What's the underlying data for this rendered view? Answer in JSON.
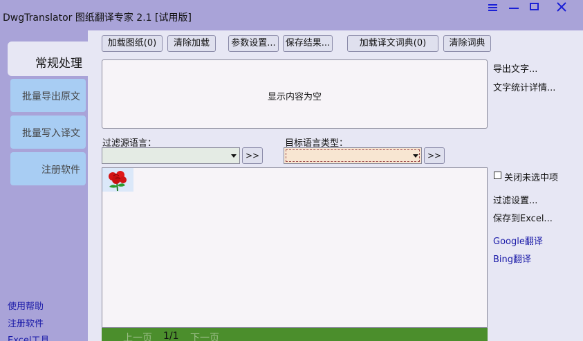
{
  "window": {
    "title": "DwgTranslator 图纸翻译专家 2.1 [试用版]",
    "controls": [
      "menu-icon",
      "minimize-icon",
      "maximize-icon",
      "close-icon"
    ]
  },
  "sidebar": {
    "tabs": [
      {
        "label": "常规处理",
        "active": true
      },
      {
        "label": "批量导出原文",
        "active": false
      },
      {
        "label": "批量写入译文",
        "active": false
      },
      {
        "label": "注册软件",
        "active": false
      }
    ],
    "links": [
      "使用帮助",
      "注册软件",
      "Excel工具"
    ]
  },
  "toolbar": {
    "buttons": [
      "加载图纸(0)",
      "清除加载",
      "参数设置...",
      "保存结果...",
      "加载译文词典(0)",
      "清除词典"
    ]
  },
  "display": {
    "empty_text": "显示内容为空"
  },
  "right_top_links": [
    "导出文字...",
    "文字统计详情..."
  ],
  "filters": {
    "source_label": "过滤源语言：",
    "source_value": "",
    "target_label": "目标语言类型：",
    "target_value": "",
    "go_label": ">>"
  },
  "list": {
    "items": [
      {
        "icon": "red-rose-icon"
      }
    ]
  },
  "right_panel": {
    "close_unselected_label": "关闭未选中项",
    "close_unselected_checked": false,
    "links": [
      "过滤设置...",
      "保存到Excel..."
    ],
    "translate_links": [
      "Google翻译",
      "Bing翻译"
    ]
  },
  "pager": {
    "prev": "上一页",
    "current": "1/1",
    "next": "下一页"
  },
  "colors": {
    "titlebar": "#a9a3d8",
    "panel": "#e7e7f4",
    "tab_inactive": "#a8cdf3",
    "pager_bar": "#4b8e2c",
    "window_icons": "#1a1fd6"
  }
}
